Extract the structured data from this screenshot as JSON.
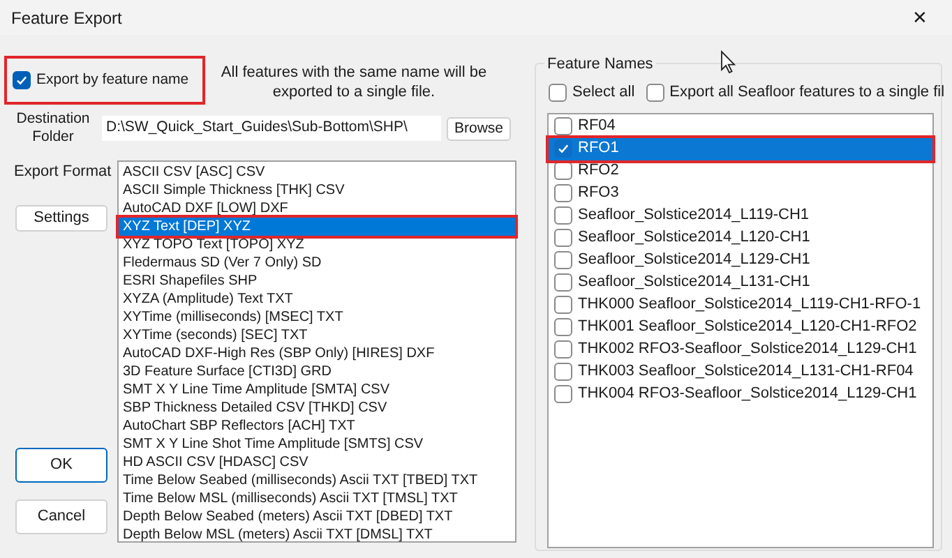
{
  "window": {
    "title": "Feature Export",
    "close": "✕"
  },
  "export_by_name": {
    "label": "Export by feature name",
    "checked": true,
    "highlighted": true
  },
  "note": "All features with the same name will be exported to a single file.",
  "destination": {
    "label": "Destination Folder",
    "value": "D:\\SW_Quick_Start_Guides\\Sub-Bottom\\SHP\\",
    "button": "Browse"
  },
  "export_format": {
    "label": "Export Format",
    "settings_button": "Settings",
    "items": [
      {
        "label": "ASCII CSV [ASC] CSV",
        "selected": false,
        "highlighted": false
      },
      {
        "label": "ASCII Simple Thickness [THK] CSV",
        "selected": false,
        "highlighted": false
      },
      {
        "label": "AutoCAD DXF [LOW] DXF",
        "selected": false,
        "highlighted": false
      },
      {
        "label": "XYZ Text [DEP] XYZ",
        "selected": true,
        "highlighted": true
      },
      {
        "label": "XYZ TOPO Text [TOPO] XYZ",
        "selected": false,
        "highlighted": false
      },
      {
        "label": "Fledermaus SD (Ver 7 Only) SD",
        "selected": false,
        "highlighted": false
      },
      {
        "label": "ESRI Shapefiles SHP",
        "selected": false,
        "highlighted": false
      },
      {
        "label": "XYZA (Amplitude) Text TXT",
        "selected": false,
        "highlighted": false
      },
      {
        "label": "XYTime (milliseconds) [MSEC] TXT",
        "selected": false,
        "highlighted": false
      },
      {
        "label": "XYTime (seconds) [SEC] TXT",
        "selected": false,
        "highlighted": false
      },
      {
        "label": "AutoCAD DXF-High Res (SBP Only) [HIRES] DXF",
        "selected": false,
        "highlighted": false
      },
      {
        "label": "3D Feature Surface [CTI3D] GRD",
        "selected": false,
        "highlighted": false
      },
      {
        "label": "SMT X Y Line Time Amplitude [SMTA] CSV",
        "selected": false,
        "highlighted": false
      },
      {
        "label": "SBP Thickness Detailed CSV [THKD] CSV",
        "selected": false,
        "highlighted": false
      },
      {
        "label": "AutoChart SBP Reflectors [ACH] TXT",
        "selected": false,
        "highlighted": false
      },
      {
        "label": "SMT X Y Line Shot Time Amplitude [SMTS] CSV",
        "selected": false,
        "highlighted": false
      },
      {
        "label": "HD ASCII CSV [HDASC] CSV",
        "selected": false,
        "highlighted": false
      },
      {
        "label": "Time Below Seabed (milliseconds) Ascii TXT [TBED] TXT",
        "selected": false,
        "highlighted": false
      },
      {
        "label": "Time Below MSL (milliseconds) Ascii TXT [TMSL] TXT",
        "selected": false,
        "highlighted": false
      },
      {
        "label": "Depth Below Seabed (meters) Ascii TXT [DBED] TXT",
        "selected": false,
        "highlighted": false
      },
      {
        "label": "Depth Below MSL (meters) Ascii TXT [DMSL] TXT",
        "selected": false,
        "highlighted": false
      }
    ]
  },
  "buttons": [
    "OK",
    "Cancel"
  ],
  "feature_names": {
    "title": "Feature Names",
    "select_all": {
      "label": "Select all",
      "checked": false
    },
    "single_file": {
      "label": "Export all Seafloor features to a single fil",
      "checked": false
    },
    "items": [
      {
        "label": "RF04",
        "checked": false,
        "selected": false,
        "highlighted": false
      },
      {
        "label": "RFO1",
        "checked": true,
        "selected": true,
        "highlighted": true
      },
      {
        "label": "RFO2",
        "checked": false,
        "selected": false,
        "highlighted": false
      },
      {
        "label": "RFO3",
        "checked": false,
        "selected": false,
        "highlighted": false
      },
      {
        "label": "Seafloor_Solstice2014_L119-CH1",
        "checked": false,
        "selected": false,
        "highlighted": false
      },
      {
        "label": "Seafloor_Solstice2014_L120-CH1",
        "checked": false,
        "selected": false,
        "highlighted": false
      },
      {
        "label": "Seafloor_Solstice2014_L129-CH1",
        "checked": false,
        "selected": false,
        "highlighted": false
      },
      {
        "label": "Seafloor_Solstice2014_L131-CH1",
        "checked": false,
        "selected": false,
        "highlighted": false
      },
      {
        "label": "THK000 Seafloor_Solstice2014_L119-CH1-RFO-1",
        "checked": false,
        "selected": false,
        "highlighted": false
      },
      {
        "label": "THK001 Seafloor_Solstice2014_L120-CH1-RFO2",
        "checked": false,
        "selected": false,
        "highlighted": false
      },
      {
        "label": "THK002 RFO3-Seafloor_Solstice2014_L129-CH1",
        "checked": false,
        "selected": false,
        "highlighted": false
      },
      {
        "label": "THK003 Seafloor_Solstice2014_L131-CH1-RF04",
        "checked": false,
        "selected": false,
        "highlighted": false
      },
      {
        "label": "THK004 RFO3-Seafloor_Solstice2014_L129-CH1",
        "checked": false,
        "selected": false,
        "highlighted": false
      }
    ]
  }
}
